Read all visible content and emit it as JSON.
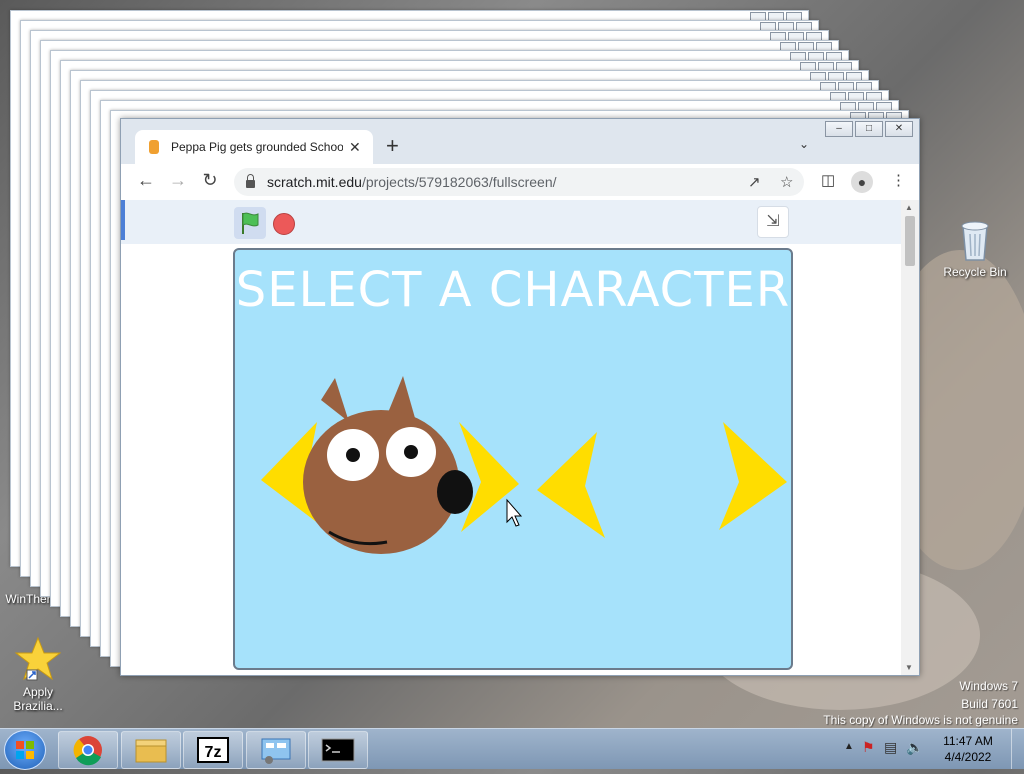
{
  "desktop": {
    "icons": [
      {
        "id": "recycle-bin",
        "label": "Recycle Bin"
      },
      {
        "id": "apply-brazilia",
        "label": "Apply\nBrazilia..."
      },
      {
        "id": "winther",
        "label": "WinTher"
      }
    ],
    "watermark": {
      "line1": "Windows 7",
      "line2": "Build 7601",
      "line3": "This copy of Windows is not genuine"
    }
  },
  "browser": {
    "tab_title": "Peppa Pig gets grounded School",
    "url_host": "scratch.mit.edu",
    "url_path": "/projects/579182063/fullscreen/",
    "icons": {
      "back": "back-arrow-icon",
      "forward": "forward-arrow-icon",
      "reload": "reload-icon",
      "share": "share-icon",
      "star": "bookmark-star-icon",
      "sidebar": "side-panel-icon",
      "profile": "profile-icon",
      "menu": "kebab-menu-icon"
    }
  },
  "scratch": {
    "stage_title": "SELECT A CHARACTER"
  },
  "taskbar": {
    "clock_time": "11:47 AM",
    "clock_date": "4/4/2022"
  }
}
